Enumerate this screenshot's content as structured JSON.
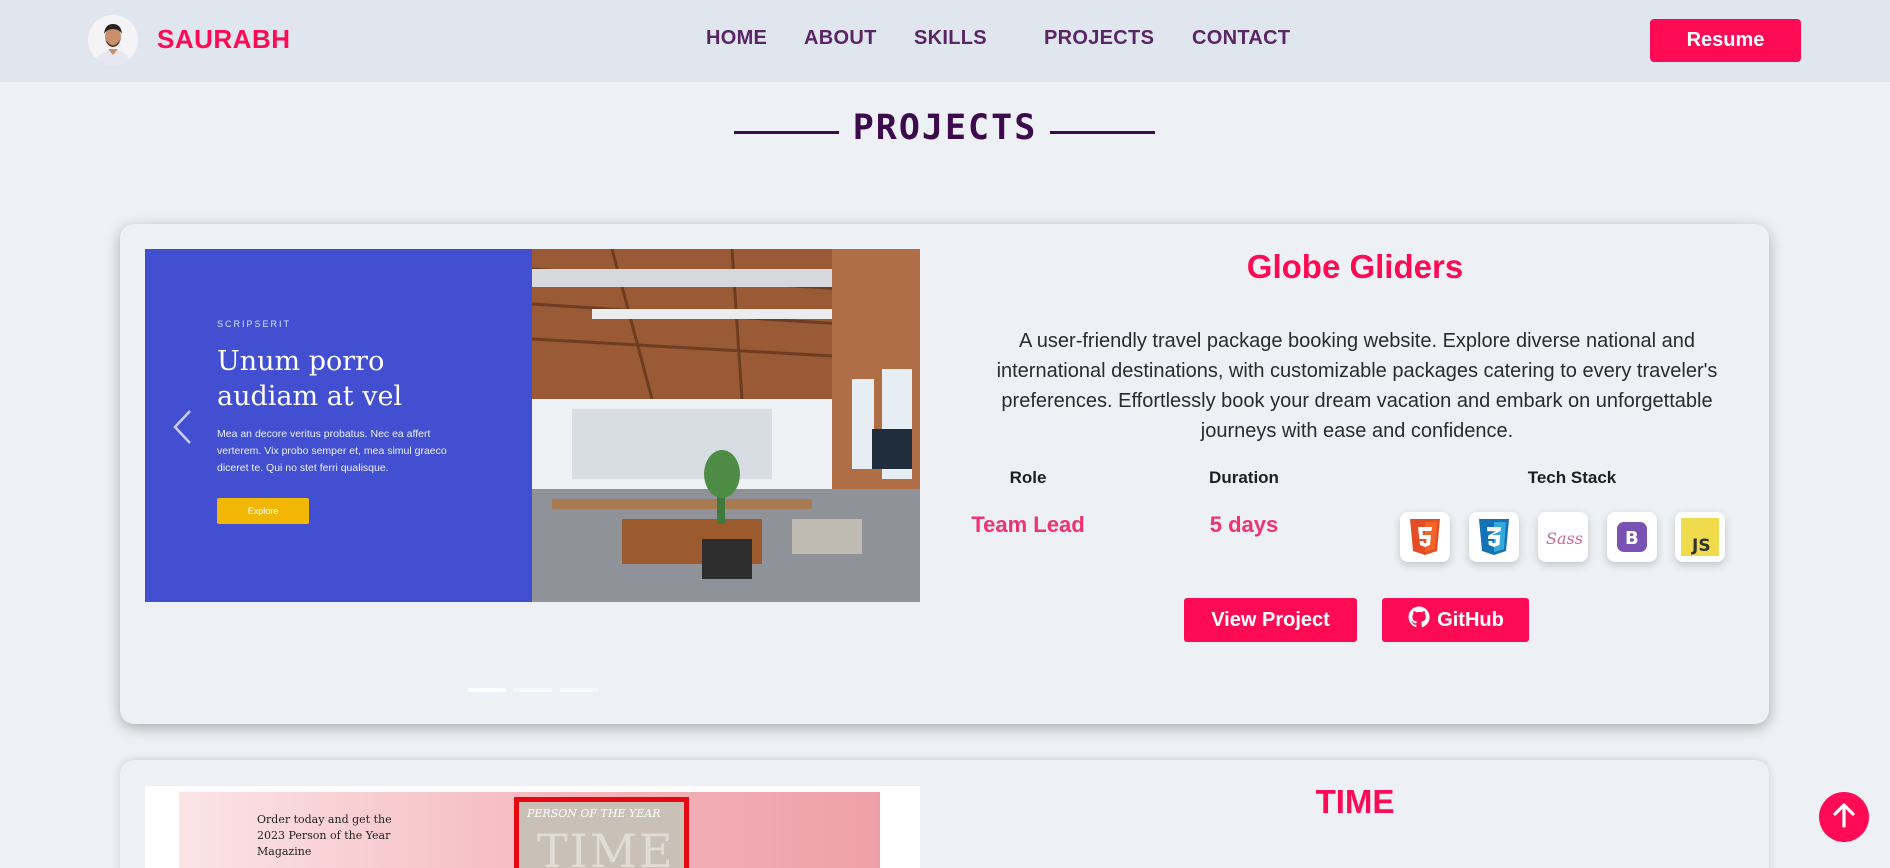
{
  "header": {
    "brand": "SAURABH",
    "nav": [
      "HOME",
      "ABOUT",
      "SKILLS",
      "PROJECTS",
      "CONTACT"
    ],
    "resume_label": "Resume"
  },
  "section": {
    "title": "PROJECTS"
  },
  "project1": {
    "title": "Globe Gliders",
    "description": "A user-friendly travel package booking website. Explore diverse national and international destinations, with customizable packages catering to every traveler's preferences. Effortlessly book your dream vacation and embark on unforgettable journeys with ease and confidence.",
    "role_label": "Role",
    "role_value": "Team Lead",
    "duration_label": "Duration",
    "duration_value": "5 days",
    "tech_label": "Tech Stack",
    "tech_icons": [
      "html5-icon",
      "css3-icon",
      "sass-icon",
      "bootstrap-icon",
      "javascript-icon"
    ],
    "view_label": "View Project",
    "github_label": "GitHub",
    "slide": {
      "kicker": "SCRIPSERIT",
      "heading": "Unum porro audiam at vel",
      "text": "Mea an decore veritus probatus. Nec ea affert verterem. Vix probo semper et, mea simul graeco diceret te. Qui no stet ferri qualisque.",
      "button": "Explore"
    }
  },
  "project2": {
    "title": "TIME",
    "slide_text": "Order today and get the 2023 Person of the Year Magazine",
    "cover_top": "PERSON OF THE YEAR",
    "cover_logo": "TIME"
  },
  "colors": {
    "accent": "#ff0a54",
    "nav": "#5a2566",
    "title": "#3d0a4d",
    "slide": "#424fd1"
  }
}
